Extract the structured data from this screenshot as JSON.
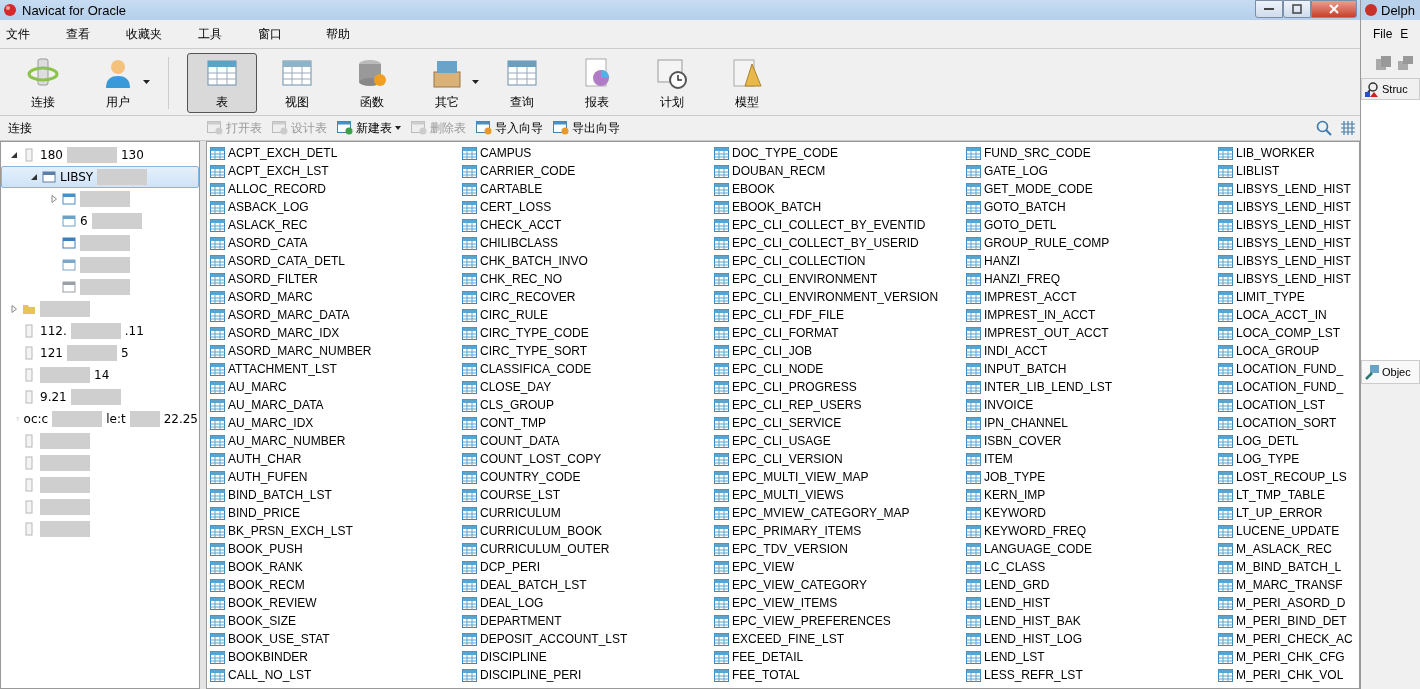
{
  "window": {
    "title": "Navicat for Oracle"
  },
  "menu": [
    "文件",
    "查看",
    "收藏夹",
    "工具",
    "窗口",
    "帮助"
  ],
  "toolbar": [
    {
      "kind": "connection",
      "label": "连接",
      "dropdown": false,
      "selected": false
    },
    {
      "kind": "user",
      "label": "用户",
      "dropdown": true,
      "selected": false
    },
    {
      "kind": "table",
      "label": "表",
      "dropdown": false,
      "selected": true
    },
    {
      "kind": "view",
      "label": "视图",
      "dropdown": false,
      "selected": false
    },
    {
      "kind": "function",
      "label": "函数",
      "dropdown": false,
      "selected": false
    },
    {
      "kind": "other",
      "label": "其它",
      "dropdown": true,
      "selected": false
    },
    {
      "kind": "query",
      "label": "查询",
      "dropdown": false,
      "selected": false
    },
    {
      "kind": "report",
      "label": "报表",
      "dropdown": false,
      "selected": false
    },
    {
      "kind": "schedule",
      "label": "计划",
      "dropdown": false,
      "selected": false
    },
    {
      "kind": "model",
      "label": "模型",
      "dropdown": false,
      "selected": false
    }
  ],
  "sidebar": {
    "title": "连接",
    "tree": [
      {
        "kind": "connection",
        "start": "180",
        "end": "130",
        "expanded": true,
        "selected": false,
        "children": [
          {
            "kind": "schema",
            "start": "LIBSY",
            "expanded": true,
            "selected": true,
            "children": [
              {
                "kind": "tables",
                "expanded": false,
                "selected": false
              },
              {
                "kind": "views",
                "start": "6",
                "selected": false
              },
              {
                "kind": "functions",
                "selected": false
              },
              {
                "kind": "queries",
                "selected": false
              },
              {
                "kind": "reports",
                "selected": false
              }
            ]
          }
        ]
      },
      {
        "kind": "folder",
        "expanded": false,
        "selected": false
      },
      {
        "kind": "connection",
        "start": "112.",
        "end": ".11",
        "selected": false
      },
      {
        "kind": "connection",
        "start": "121",
        "end": "5",
        "selected": false
      },
      {
        "kind": "connection",
        "end": "14",
        "selected": false
      },
      {
        "kind": "connection",
        "start": "9.21",
        "selected": false
      },
      {
        "kind": "connection",
        "start": "oc:c",
        "middle": "le:t",
        "end": "22.25",
        "selected": false
      },
      {
        "kind": "connection",
        "selected": false
      },
      {
        "kind": "connection",
        "selected": false
      },
      {
        "kind": "connection",
        "selected": false
      },
      {
        "kind": "connection",
        "selected": false
      },
      {
        "kind": "connection",
        "selected": false
      }
    ]
  },
  "actions": [
    {
      "label": "打开表",
      "disabled": true,
      "dropdown": false
    },
    {
      "label": "设计表",
      "disabled": true,
      "dropdown": false
    },
    {
      "label": "新建表",
      "disabled": false,
      "dropdown": true
    },
    {
      "label": "删除表",
      "disabled": true,
      "dropdown": false
    },
    {
      "label": "导入向导",
      "disabled": false,
      "dropdown": false
    },
    {
      "label": "导出向导",
      "disabled": false,
      "dropdown": false
    }
  ],
  "tables": [
    [
      "ACPT_EXCH_DETL",
      "ACPT_EXCH_LST",
      "ALLOC_RECORD",
      "ASBACK_LOG",
      "ASLACK_REC",
      "ASORD_CATA",
      "ASORD_CATA_DETL",
      "ASORD_FILTER",
      "ASORD_MARC",
      "ASORD_MARC_DATA",
      "ASORD_MARC_IDX",
      "ASORD_MARC_NUMBER",
      "ATTACHMENT_LST",
      "AU_MARC",
      "AU_MARC_DATA",
      "AU_MARC_IDX",
      "AU_MARC_NUMBER",
      "AUTH_CHAR",
      "AUTH_FUFEN",
      "BIND_BATCH_LST",
      "BIND_PRICE",
      "BK_PRSN_EXCH_LST",
      "BOOK_PUSH",
      "BOOK_RANK",
      "BOOK_RECM",
      "BOOK_REVIEW",
      "BOOK_SIZE",
      "BOOK_USE_STAT",
      "BOOKBINDER",
      "CALL_NO_LST"
    ],
    [
      "CAMPUS",
      "CARRIER_CODE",
      "CARTABLE",
      "CERT_LOSS",
      "CHECK_ACCT",
      "CHILIBCLASS",
      "CHK_BATCH_INVO",
      "CHK_REC_NO",
      "CIRC_RECOVER",
      "CIRC_RULE",
      "CIRC_TYPE_CODE",
      "CIRC_TYPE_SORT",
      "CLASSIFICA_CODE",
      "CLOSE_DAY",
      "CLS_GROUP",
      "CONT_TMP",
      "COUNT_DATA",
      "COUNT_LOST_COPY",
      "COUNTRY_CODE",
      "COURSE_LST",
      "CURRICULUM",
      "CURRICULUM_BOOK",
      "CURRICULUM_OUTER",
      "DCP_PERI",
      "DEAL_BATCH_LST",
      "DEAL_LOG",
      "DEPARTMENT",
      "DEPOSIT_ACCOUNT_LST",
      "DISCIPLINE",
      "DISCIPLINE_PERI"
    ],
    [
      "DOC_TYPE_CODE",
      "DOUBAN_RECM",
      "EBOOK",
      "EBOOK_BATCH",
      "EPC_CLI_COLLECT_BY_EVENTID",
      "EPC_CLI_COLLECT_BY_USERID",
      "EPC_CLI_COLLECTION",
      "EPC_CLI_ENVIRONMENT",
      "EPC_CLI_ENVIRONMENT_VERSION",
      "EPC_CLI_FDF_FILE",
      "EPC_CLI_FORMAT",
      "EPC_CLI_JOB",
      "EPC_CLI_NODE",
      "EPC_CLI_PROGRESS",
      "EPC_CLI_REP_USERS",
      "EPC_CLI_SERVICE",
      "EPC_CLI_USAGE",
      "EPC_CLI_VERSION",
      "EPC_MULTI_VIEW_MAP",
      "EPC_MULTI_VIEWS",
      "EPC_MVIEW_CATEGORY_MAP",
      "EPC_PRIMARY_ITEMS",
      "EPC_TDV_VERSION",
      "EPC_VIEW",
      "EPC_VIEW_CATEGORY",
      "EPC_VIEW_ITEMS",
      "EPC_VIEW_PREFERENCES",
      "EXCEED_FINE_LST",
      "FEE_DETAIL",
      "FEE_TOTAL"
    ],
    [
      "FUND_SRC_CODE",
      "GATE_LOG",
      "GET_MODE_CODE",
      "GOTO_BATCH",
      "GOTO_DETL",
      "GROUP_RULE_COMP",
      "HANZI",
      "HANZI_FREQ",
      "IMPREST_ACCT",
      "IMPREST_IN_ACCT",
      "IMPREST_OUT_ACCT",
      "INDI_ACCT",
      "INPUT_BATCH",
      "INTER_LIB_LEND_LST",
      "INVOICE",
      "IPN_CHANNEL",
      "ISBN_COVER",
      "ITEM",
      "JOB_TYPE",
      "KERN_IMP",
      "KEYWORD",
      "KEYWORD_FREQ",
      "LANGUAGE_CODE",
      "LC_CLASS",
      "LEND_GRD",
      "LEND_HIST",
      "LEND_HIST_BAK",
      "LEND_HIST_LOG",
      "LEND_LST",
      "LESS_REFR_LST"
    ],
    [
      "LIB_WORKER",
      "LIBLIST",
      "LIBSYS_LEND_HIST",
      "LIBSYS_LEND_HIST",
      "LIBSYS_LEND_HIST",
      "LIBSYS_LEND_HIST",
      "LIBSYS_LEND_HIST",
      "LIBSYS_LEND_HIST",
      "LIMIT_TYPE",
      "LOCA_ACCT_IN",
      "LOCA_COMP_LST",
      "LOCA_GROUP",
      "LOCATION_FUND_",
      "LOCATION_FUND_",
      "LOCATION_LST",
      "LOCATION_SORT",
      "LOG_DETL",
      "LOG_TYPE",
      "LOST_RECOUP_LS",
      "LT_TMP_TABLE",
      "LT_UP_ERROR",
      "LUCENE_UPDATE",
      "M_ASLACK_REC",
      "M_BIND_BATCH_L",
      "M_MARC_TRANSF",
      "M_PERI_ASORD_D",
      "M_PERI_BIND_DET",
      "M_PERI_CHECK_AC",
      "M_PERI_CHK_CFG",
      "M_PERI_CHK_VOL"
    ]
  ],
  "side_window": {
    "title": "Delph",
    "menu": [
      "File",
      "E"
    ],
    "panel": "Struc",
    "tab": "Objec"
  }
}
